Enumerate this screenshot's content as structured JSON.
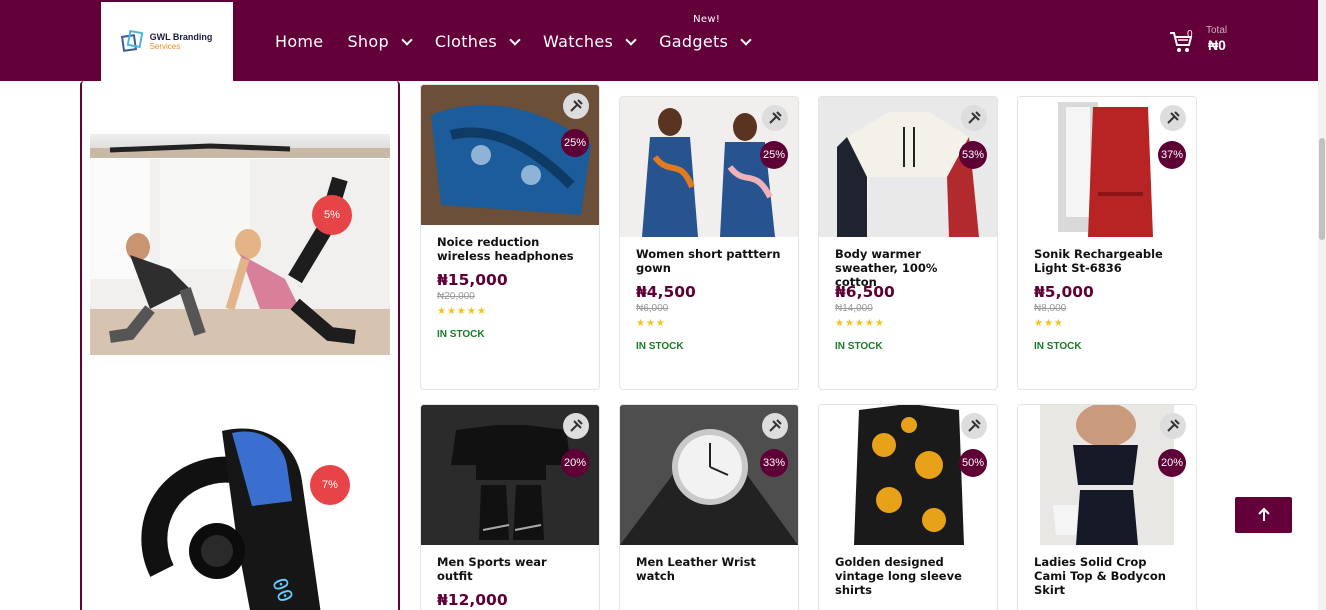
{
  "brand": {
    "line1": "GWL Branding",
    "line2": "Services"
  },
  "nav": {
    "items": [
      {
        "label": "Home",
        "has_dropdown": false
      },
      {
        "label": "Shop",
        "has_dropdown": true
      },
      {
        "label": "Clothes",
        "has_dropdown": true
      },
      {
        "label": "Watches",
        "has_dropdown": true
      },
      {
        "label": "Gadgets",
        "has_dropdown": true
      }
    ],
    "new_badge": "New!"
  },
  "cart": {
    "count": "0",
    "total_label": "Total",
    "total_value": "₦0"
  },
  "promo": {
    "badge1": "5%",
    "badge2": "7%"
  },
  "products": [
    {
      "name": "Noice reduction wireless headphones",
      "price": "₦15,000",
      "old_price": "₦20,000",
      "stars": "★★★★★",
      "stock": "IN STOCK",
      "discount": "25%"
    },
    {
      "name": "Women short patttern gown",
      "price": "₦4,500",
      "old_price": "₦6,000",
      "stars": "★★★",
      "stock": "IN STOCK",
      "discount": "25%"
    },
    {
      "name": "Body warmer sweather, 100% cotton",
      "price": "₦6,500",
      "old_price": "₦14,000",
      "stars": "★★★★★",
      "stock": "IN STOCK",
      "discount": "53%"
    },
    {
      "name": "Sonik Rechargeable Light St-6836",
      "price": "₦5,000",
      "old_price": "₦8,000",
      "stars": "★★★",
      "stock": "IN STOCK",
      "discount": "37%"
    },
    {
      "name": "Men Sports wear outfit",
      "price": "₦12,000",
      "old_price": "",
      "stars": "",
      "stock": "",
      "discount": "20%"
    },
    {
      "name": "Men Leather Wrist watch",
      "price": "",
      "old_price": "",
      "stars": "",
      "stock": "",
      "discount": "33%"
    },
    {
      "name": "Golden designed vintage long sleeve shirts",
      "price": "",
      "old_price": "",
      "stars": "",
      "stock": "",
      "discount": "50%"
    },
    {
      "name": "Ladies Solid Crop Cami Top & Bodycon Skirt",
      "price": "",
      "old_price": "",
      "stars": "",
      "stock": "",
      "discount": "20%"
    }
  ],
  "colors": {
    "brand": "#63003a",
    "discount": "#5e0035",
    "promo_badge": "#e74447",
    "stock": "#1a7a2a",
    "stars": "#f3c31a"
  }
}
